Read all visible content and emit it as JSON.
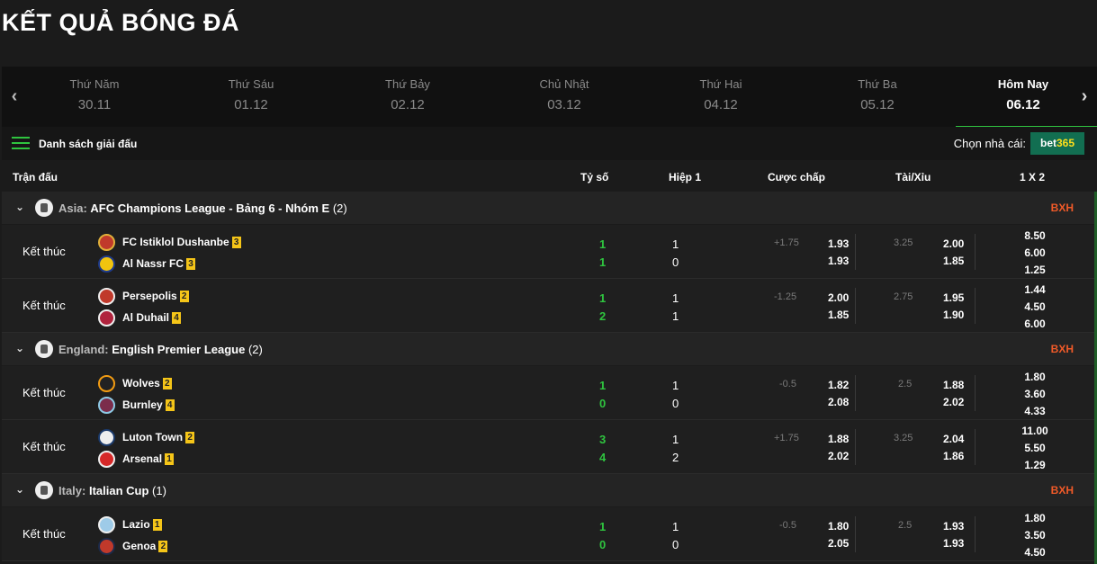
{
  "page": {
    "title": "KẾT QUẢ BÓNG ĐÁ"
  },
  "date_nav": {
    "prev_icon": "chevron-left-icon",
    "next_icon": "chevron-right-icon",
    "days": [
      {
        "name": "Thứ Năm",
        "date": "30.11"
      },
      {
        "name": "Thứ Sáu",
        "date": "01.12"
      },
      {
        "name": "Thứ Bảy",
        "date": "02.12"
      },
      {
        "name": "Chủ Nhật",
        "date": "03.12"
      },
      {
        "name": "Thứ Hai",
        "date": "04.12"
      },
      {
        "name": "Thứ Ba",
        "date": "05.12"
      },
      {
        "name": "Hôm Nay",
        "date": "06.12",
        "active": true
      }
    ]
  },
  "subbar": {
    "league_list_label": "Danh sách giải đấu",
    "bookmaker_label": "Chọn nhà cái:",
    "bookmaker_badge_a": "bet",
    "bookmaker_badge_b": "365"
  },
  "table_header": {
    "match": "Trận đấu",
    "score": "Tỷ số",
    "half1": "Hiệp 1",
    "handicap": "Cược chấp",
    "over_under": "Tài/Xỉu",
    "x12": "1 X 2"
  },
  "colors": {
    "accent": "#2fc43f",
    "bxh": "#f05a28",
    "rank_badge": "#f5c518"
  },
  "leagues": [
    {
      "country": "Asia:",
      "name": "AFC Champions League - Bảng 6 - Nhóm E",
      "count": "(2)",
      "bxh": "BXH",
      "matches": [
        {
          "status": "Kết thúc",
          "home": {
            "name": "FC Istiklol Dushanbe",
            "rank": "3"
          },
          "away": {
            "name": "Al Nassr FC",
            "rank": "3"
          },
          "score": [
            "1",
            "1"
          ],
          "half1": [
            "1",
            "0"
          ],
          "handicap_line": "+1.75",
          "handicap_odds": [
            "1.93",
            "1.93"
          ],
          "ou_line": "3.25",
          "ou_odds": [
            "2.00",
            "1.85"
          ],
          "x12": [
            "8.50",
            "6.00",
            "1.25"
          ]
        },
        {
          "status": "Kết thúc",
          "home": {
            "name": "Persepolis",
            "rank": "2"
          },
          "away": {
            "name": "Al Duhail",
            "rank": "4"
          },
          "score": [
            "1",
            "2"
          ],
          "half1": [
            "1",
            "1"
          ],
          "handicap_line": "-1.25",
          "handicap_odds": [
            "2.00",
            "1.85"
          ],
          "ou_line": "2.75",
          "ou_odds": [
            "1.95",
            "1.90"
          ],
          "x12": [
            "1.44",
            "4.50",
            "6.00"
          ]
        }
      ]
    },
    {
      "country": "England:",
      "name": "English Premier League",
      "count": "(2)",
      "bxh": "BXH",
      "matches": [
        {
          "status": "Kết thúc",
          "home": {
            "name": "Wolves",
            "rank": "2"
          },
          "away": {
            "name": "Burnley",
            "rank": "4"
          },
          "score": [
            "1",
            "0"
          ],
          "half1": [
            "1",
            "0"
          ],
          "handicap_line": "-0.5",
          "handicap_odds": [
            "1.82",
            "2.08"
          ],
          "ou_line": "2.5",
          "ou_odds": [
            "1.88",
            "2.02"
          ],
          "x12": [
            "1.80",
            "3.60",
            "4.33"
          ]
        },
        {
          "status": "Kết thúc",
          "home": {
            "name": "Luton Town",
            "rank": "2"
          },
          "away": {
            "name": "Arsenal",
            "rank": "1"
          },
          "score": [
            "3",
            "4"
          ],
          "half1": [
            "1",
            "2"
          ],
          "handicap_line": "+1.75",
          "handicap_odds": [
            "1.88",
            "2.02"
          ],
          "ou_line": "3.25",
          "ou_odds": [
            "2.04",
            "1.86"
          ],
          "x12": [
            "11.00",
            "5.50",
            "1.29"
          ]
        }
      ]
    },
    {
      "country": "Italy:",
      "name": "Italian Cup",
      "count": "(1)",
      "bxh": "BXH",
      "matches": [
        {
          "status": "Kết thúc",
          "home": {
            "name": "Lazio",
            "rank": "1"
          },
          "away": {
            "name": "Genoa",
            "rank": "2"
          },
          "score": [
            "1",
            "0"
          ],
          "half1": [
            "1",
            "0"
          ],
          "handicap_line": "-0.5",
          "handicap_odds": [
            "1.80",
            "2.05"
          ],
          "ou_line": "2.5",
          "ou_odds": [
            "1.93",
            "1.93"
          ],
          "x12": [
            "1.80",
            "3.50",
            "4.50"
          ]
        }
      ]
    }
  ]
}
